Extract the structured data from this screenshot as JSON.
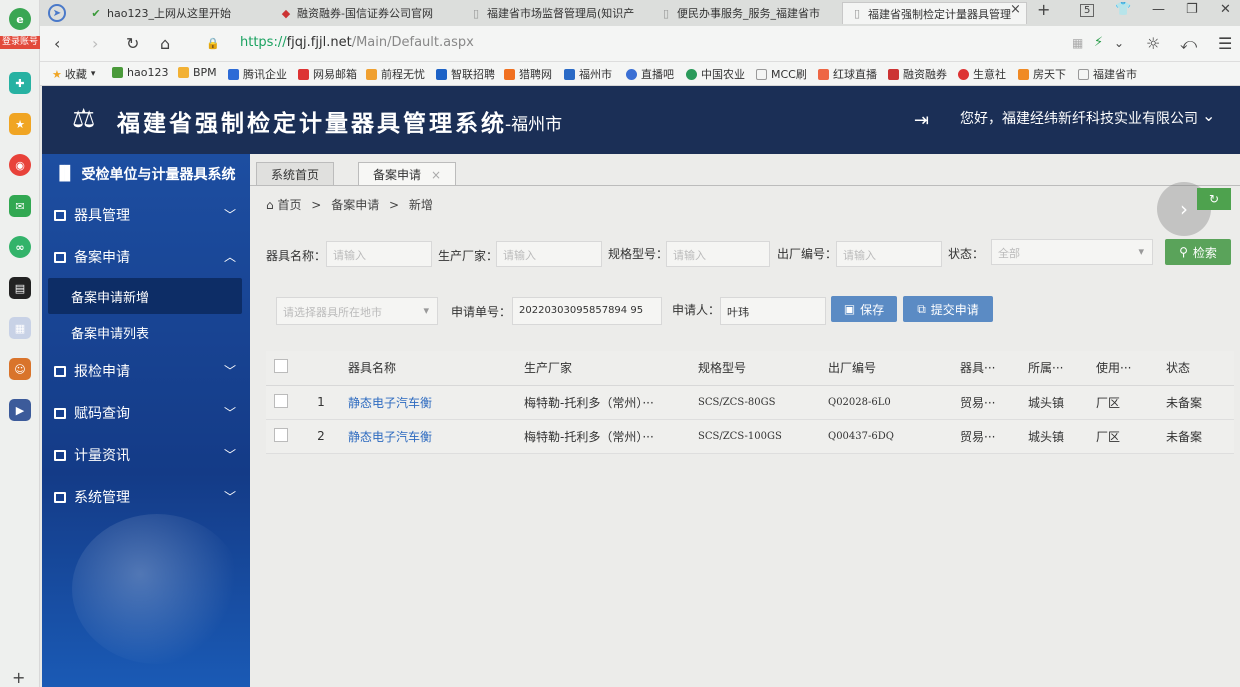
{
  "browser": {
    "badge": "登录账号",
    "tabs": [
      {
        "label": "hao123_上网从这里开始"
      },
      {
        "label": "融资融券-国信证券公司官网"
      },
      {
        "label": "福建省市场监督管理局(知识产"
      },
      {
        "label": "便民办事服务_服务_福建省市"
      },
      {
        "label": "福建省强制检定计量器具管理"
      }
    ],
    "tab_count": "5",
    "url_scheme": "https://",
    "url_host": "fjqj.fjjl.net",
    "url_path": "/Main/Default.aspx",
    "bookmarks": [
      "收藏",
      "hao123",
      "BPM",
      "腾讯企业",
      "网易邮箱",
      "前程无忧",
      "智联招聘",
      "猎聘网",
      "福州市",
      "直播吧",
      "中国农业",
      "MCC刷",
      "红球直播",
      "融资融券",
      "生意社",
      "房天下",
      "福建省市"
    ]
  },
  "header": {
    "title": "福建省强制检定计量器具管理系统",
    "subtitle": "-福州市",
    "greeting": "您好，福建经纬新纤科技实业有限公司"
  },
  "sidebar": {
    "title": "受检单位与计量器具系统",
    "items": [
      {
        "label": "器具管理",
        "arrow": "﹀"
      },
      {
        "label": "备案申请",
        "arrow": "︿"
      },
      {
        "label": "报检申请",
        "arrow": "﹀"
      },
      {
        "label": "赋码查询",
        "arrow": "﹀"
      },
      {
        "label": "计量资讯",
        "arrow": "﹀"
      },
      {
        "label": "系统管理",
        "arrow": "﹀"
      }
    ],
    "subitems": [
      "备案申请新增",
      "备案申请列表"
    ]
  },
  "page_tabs": [
    "系统首页",
    "备案申请"
  ],
  "breadcrumb": {
    "home": "首页",
    "sep": ">",
    "level1": "备案申请",
    "level2": "新增"
  },
  "filters": {
    "name_label": "器具名称：",
    "name_placeholder": "请输入",
    "maker_label": "生产厂家：",
    "maker_placeholder": "请输入",
    "model_label": "规格型号：",
    "model_placeholder": "请输入",
    "serial_label": "出厂编号：",
    "serial_placeholder": "请输入",
    "status_label": "状态：",
    "status_value": "全部",
    "search_button": "检索"
  },
  "form": {
    "location_placeholder": "请选择器具所在地市",
    "order_label": "申请单号：",
    "order_value": "20220303095857894 95",
    "applicant_label": "申请人：",
    "applicant_value": "叶玮",
    "save_button": "保存",
    "submit_button": "提交申请"
  },
  "table": {
    "headers": [
      "",
      "",
      "器具名称",
      "生产厂家",
      "规格型号",
      "出厂编号",
      "器具···",
      "所属···",
      "使用···",
      "状态"
    ],
    "rows": [
      {
        "num": "1",
        "name": "静态电子汽车衡",
        "maker": "梅特勒-托利多（常州）···",
        "model": "SCS/ZCS-80GS",
        "serial": "Q02028-6L0",
        "type": "贸易···",
        "belong": "城头镇",
        "use": "厂区",
        "status": "未备案"
      },
      {
        "num": "2",
        "name": "静态电子汽车衡",
        "maker": "梅特勒-托利多（常州）···",
        "model": "SCS/ZCS-100GS",
        "serial": "Q00437-6DQ",
        "type": "贸易···",
        "belong": "城头镇",
        "use": "厂区",
        "status": "未备案"
      }
    ]
  },
  "colors": {
    "header_bg": "#1b2f56",
    "sidebar_bg": "#1d4ea1",
    "accent_green": "#5aa35a",
    "accent_blue": "#5b8bc4",
    "link": "#2e6bc0"
  }
}
